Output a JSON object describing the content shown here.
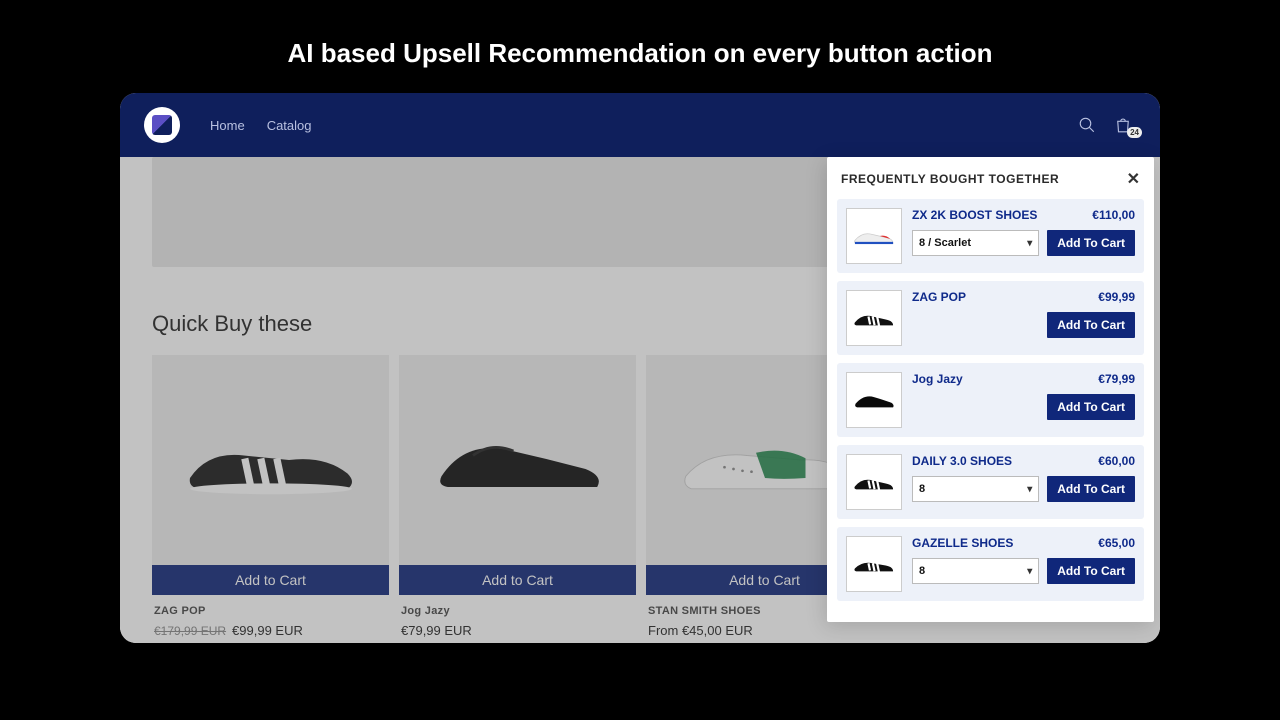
{
  "headline": "AI based Upsell Recommendation on every button action",
  "nav": {
    "home": "Home",
    "catalog": "Catalog",
    "cart_badge": "24"
  },
  "quick_title": "Quick Buy these",
  "add_to_cart_label": "Add to Cart",
  "cards": [
    {
      "name": "ZAG POP",
      "price_strike": "€179,99 EUR",
      "price": "€99,99 EUR"
    },
    {
      "name": "Jog Jazy",
      "price": "€79,99 EUR"
    },
    {
      "name": "STAN SMITH SHOES",
      "price": "From €45,00 EUR"
    }
  ],
  "panel": {
    "title": "FREQUENTLY BOUGHT TOGETHER",
    "close": "✕",
    "add_label": "Add To Cart",
    "items": [
      {
        "name": "ZX 2K BOOST SHOES",
        "price": "€110,00",
        "variant": "8 / Scarlet",
        "has_variant": true
      },
      {
        "name": "ZAG POP",
        "price": "€99,99",
        "has_variant": false
      },
      {
        "name": "Jog Jazy",
        "price": "€79,99",
        "has_variant": false
      },
      {
        "name": "DAILY 3.0 SHOES",
        "price": "€60,00",
        "variant": "8",
        "has_variant": true
      },
      {
        "name": "GAZELLE SHOES",
        "price": "€65,00",
        "variant": "8",
        "has_variant": true
      }
    ]
  }
}
